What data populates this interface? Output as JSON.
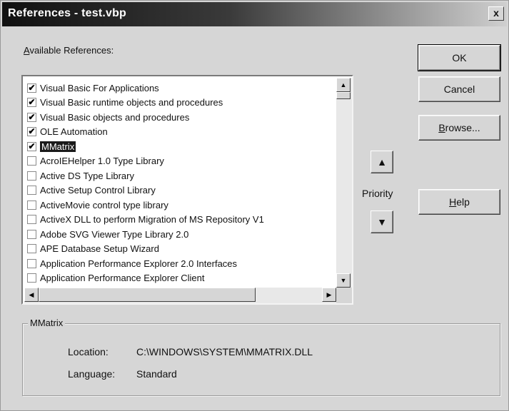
{
  "window": {
    "title": "References - test.vbp",
    "close_glyph": "x"
  },
  "available_label": {
    "accel": "A",
    "rest": "vailable References:"
  },
  "references": [
    {
      "label": "Visual Basic For Applications",
      "checked": true,
      "selected": false
    },
    {
      "label": "Visual Basic runtime objects and procedures",
      "checked": true,
      "selected": false
    },
    {
      "label": "Visual Basic objects and procedures",
      "checked": true,
      "selected": false
    },
    {
      "label": "OLE Automation",
      "checked": true,
      "selected": false
    },
    {
      "label": "MMatrix",
      "checked": true,
      "selected": true
    },
    {
      "label": "AcroIEHelper 1.0 Type Library",
      "checked": false,
      "selected": false
    },
    {
      "label": "Active DS Type Library",
      "checked": false,
      "selected": false
    },
    {
      "label": "Active Setup Control Library",
      "checked": false,
      "selected": false
    },
    {
      "label": "ActiveMovie control type library",
      "checked": false,
      "selected": false
    },
    {
      "label": "ActiveX DLL to perform Migration of MS Repository V1",
      "checked": false,
      "selected": false
    },
    {
      "label": "Adobe SVG Viewer Type Library 2.0",
      "checked": false,
      "selected": false
    },
    {
      "label": "APE Database Setup Wizard",
      "checked": false,
      "selected": false
    },
    {
      "label": "Application Performance Explorer 2.0 Interfaces",
      "checked": false,
      "selected": false
    },
    {
      "label": "Application Performance Explorer Client",
      "checked": false,
      "selected": false
    }
  ],
  "buttons": {
    "ok": "OK",
    "cancel": "Cancel",
    "browse_accel": "B",
    "browse_rest": "rowse...",
    "help_accel": "H",
    "help_rest": "elp"
  },
  "priority": {
    "label": "Priority",
    "up_glyph": "▲",
    "down_glyph": "▼"
  },
  "scroll_glyphs": {
    "up": "▲",
    "down": "▼",
    "left": "◀",
    "right": "▶"
  },
  "details": {
    "group_title": "MMatrix",
    "location_label": "Location:",
    "location_value": "C:\\WINDOWS\\SYSTEM\\MMATRIX.DLL",
    "language_label": "Language:",
    "language_value": "Standard"
  }
}
